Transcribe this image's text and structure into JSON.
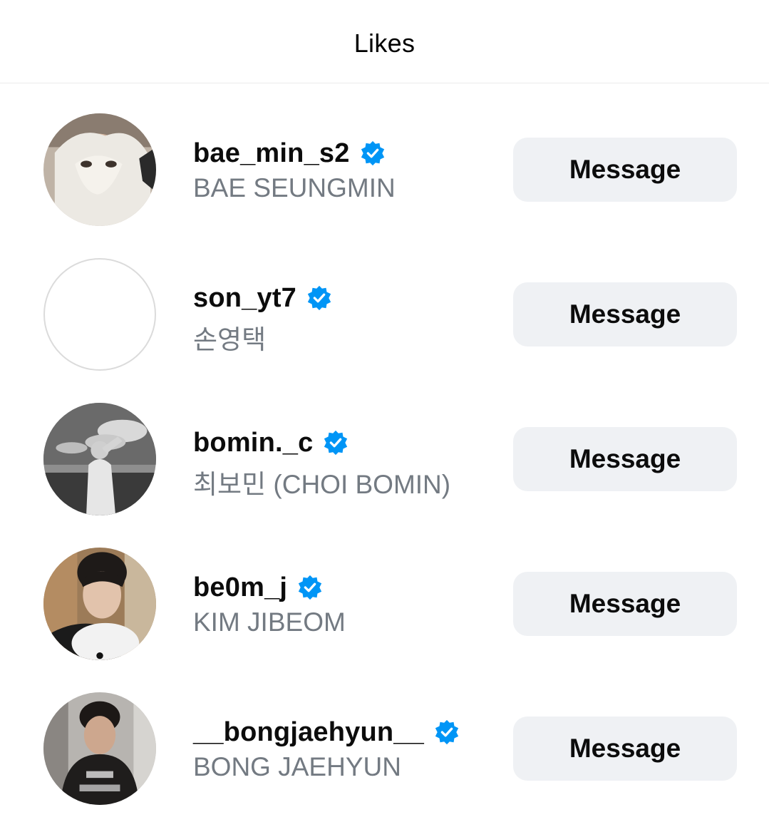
{
  "header": {
    "title": "Likes"
  },
  "users": [
    {
      "username": "bae_min_s2",
      "full_name": "BAE SEUNGMIN",
      "verified": true,
      "button_label": "Message"
    },
    {
      "username": "son_yt7",
      "full_name": "손영택",
      "verified": true,
      "button_label": "Message"
    },
    {
      "username": "bomin._c",
      "full_name": "최보민 (CHOI BOMIN)",
      "verified": true,
      "button_label": "Message"
    },
    {
      "username": "be0m_j",
      "full_name": "KIM JIBEOM",
      "verified": true,
      "button_label": "Message"
    },
    {
      "username": "__bongjaehyun__",
      "full_name": "BONG JAEHYUN",
      "verified": true,
      "button_label": "Message"
    }
  ],
  "icons": {
    "verified": "verified-badge-icon"
  },
  "colors": {
    "verified_blue": "#0095f6",
    "button_bg": "#eff1f4",
    "secondary_text": "#737a82"
  }
}
